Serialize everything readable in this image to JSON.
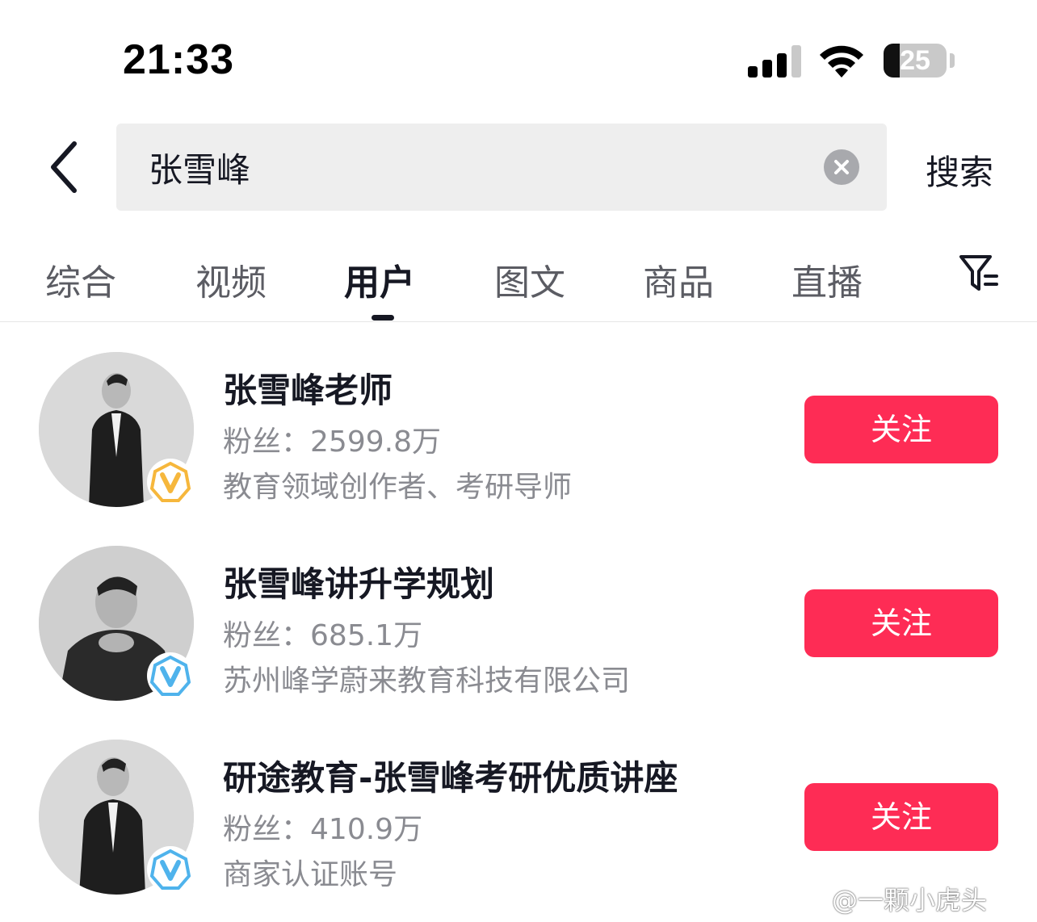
{
  "status_bar": {
    "time": "21:33",
    "battery": "25",
    "battery_level": 0.25
  },
  "search": {
    "query": "张雪峰",
    "submit_label": "搜索"
  },
  "tabs": [
    {
      "label": "综合",
      "active": false
    },
    {
      "label": "视频",
      "active": false
    },
    {
      "label": "用户",
      "active": true
    },
    {
      "label": "图文",
      "active": false
    },
    {
      "label": "商品",
      "active": false
    },
    {
      "label": "直播",
      "active": false
    }
  ],
  "users": [
    {
      "name": "张雪峰老师",
      "fans_label": "粉丝：",
      "fans_value": "2599.8万",
      "description": "教育领域创作者、考研导师",
      "badge": "gold-verified-icon",
      "badge_color": "#f6b73c",
      "follow_label": "关注"
    },
    {
      "name": "张雪峰讲升学规划",
      "fans_label": "粉丝：",
      "fans_value": "685.1万",
      "description": "苏州峰学蔚来教育科技有限公司",
      "badge": "blue-verified-icon",
      "badge_color": "#4fb3ec",
      "follow_label": "关注"
    },
    {
      "name": "研途教育-张雪峰考研优质讲座",
      "fans_label": "粉丝：",
      "fans_value": "410.9万",
      "description": "商家认证账号",
      "badge": "blue-verified-icon",
      "badge_color": "#4fb3ec",
      "follow_label": "关注"
    }
  ],
  "colors": {
    "follow_button": "#fe2c55",
    "text_primary": "#161823",
    "text_secondary": "#8a8b91",
    "search_bg": "#eeeeee"
  },
  "watermark": "@一颗小虎头"
}
